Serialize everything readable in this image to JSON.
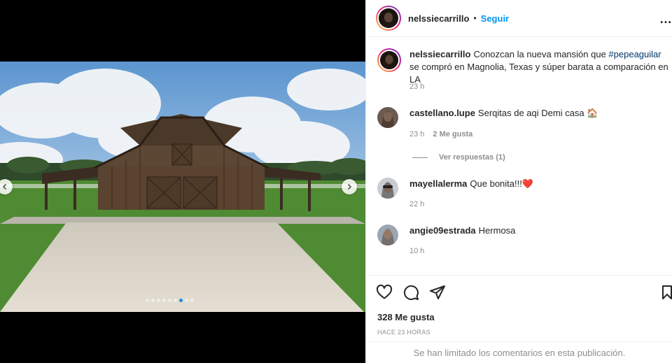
{
  "post": {
    "username": "nelssiecarrillo",
    "follow_label": "Seguir",
    "separator": "•",
    "more_label": "…"
  },
  "caption": {
    "username": "nelssiecarrillo",
    "text_before": "Conozcan la nueva mansión que ",
    "hashtag": "#pepeaguilar",
    "text_after": " se compró en Magnolia, Texas y súper barata a comparación en LA",
    "time": "23 h"
  },
  "comments": [
    {
      "username": "castellano.lupe",
      "text": "Serqitas de aqi Demi casa 🏠",
      "time": "23 h",
      "likes": "2 Me gusta"
    },
    {
      "username": "mayellalerma",
      "text": "Que bonita!!!",
      "heart": "❤️",
      "time": "22 h"
    },
    {
      "username": "angie09estrada",
      "text": "Hermosa",
      "time": "10 h"
    }
  ],
  "view_replies_label": "Ver respuestas (1)",
  "likes_count_label": "328 Me gusta",
  "posted_ago": "HACE 23 HORAS",
  "comments_limited": "Se han limitado los comentarios en esta publicación.",
  "carousel": {
    "total": 9,
    "active_index": 6
  },
  "icons": [
    "heart-icon",
    "comment-icon",
    "share-icon",
    "bookmark-icon",
    "chevron-left-icon",
    "chevron-right-icon"
  ],
  "colors": {
    "accent": "#0095f6",
    "hashtag": "#00376b",
    "muted": "#8e8e8e",
    "heart": "#ed4956"
  }
}
